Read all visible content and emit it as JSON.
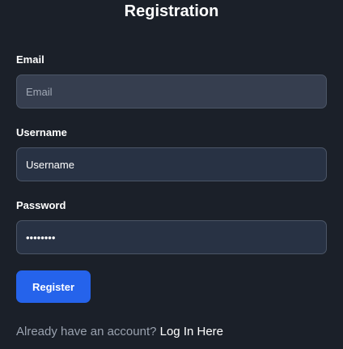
{
  "title": "Registration",
  "form": {
    "email": {
      "label": "Email",
      "placeholder": "Email",
      "value": ""
    },
    "username": {
      "label": "Username",
      "placeholder": "Username",
      "value": "Username"
    },
    "password": {
      "label": "Password",
      "value": "password"
    },
    "submit_label": "Register"
  },
  "footer": {
    "prompt": "Already have an account?",
    "link_label": "Log In Here"
  },
  "colors": {
    "background": "#1b2029",
    "accent": "#2563eb",
    "input_empty": "#363e4f",
    "input_filled": "#283244"
  }
}
